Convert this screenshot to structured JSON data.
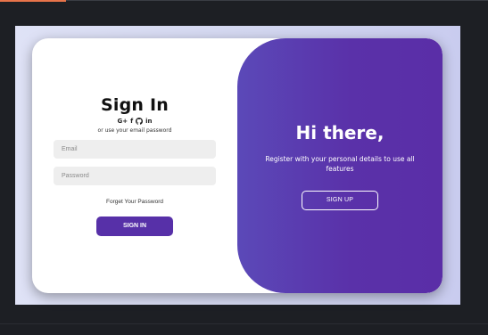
{
  "signin": {
    "title": "Sign In",
    "social_icons": [
      "G+",
      "f",
      "github",
      "in"
    ],
    "alt_text": "or use your email password",
    "email_placeholder": "Email",
    "password_placeholder": "Password",
    "forgot_link": "Forget Your Password",
    "button": "SIGN IN"
  },
  "panel": {
    "heading": "Hi there,",
    "text": "Register with your personal details to use all features",
    "button": "SIGN UP"
  },
  "colors": {
    "accent": "#5730a8",
    "panel_start": "#5b49b8",
    "panel_end": "#5a2ea7",
    "top_accent": "#e7734a"
  }
}
